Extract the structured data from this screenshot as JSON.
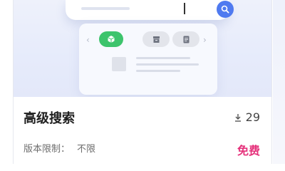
{
  "card": {
    "title": "高级搜索",
    "download_count": "29",
    "limit_label": "版本限制：",
    "limit_value": "不限",
    "price_label": "免费"
  },
  "preview": {
    "icons": [
      "search-icon",
      "box-icon",
      "archive-icon",
      "document-icon"
    ],
    "colors": {
      "accent": "#4f7af0",
      "active_pill": "#3dc46c",
      "price": "#e5327b"
    }
  }
}
